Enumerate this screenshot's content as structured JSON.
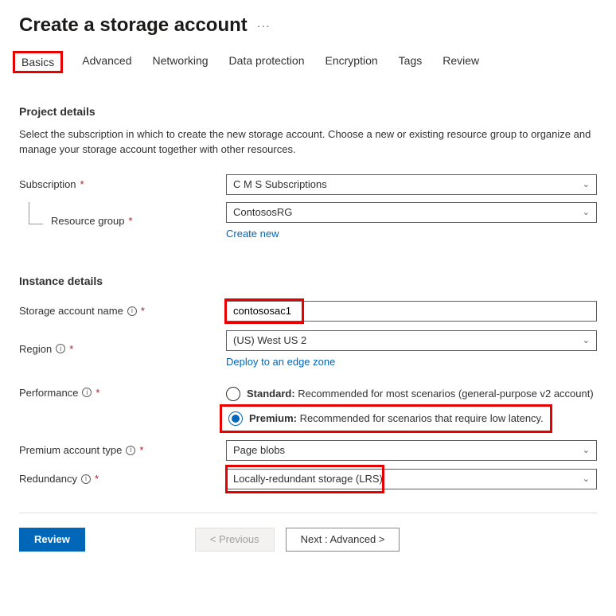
{
  "header": {
    "title": "Create a storage account",
    "ellipsis": "···"
  },
  "tabs": [
    "Basics",
    "Advanced",
    "Networking",
    "Data protection",
    "Encryption",
    "Tags",
    "Review"
  ],
  "project": {
    "heading": "Project details",
    "desc": "Select the subscription in which to create the new storage account. Choose a new or existing resource group to organize and manage your storage account together with other resources.",
    "subscription_label": "Subscription",
    "subscription_value": "C M S Subscriptions",
    "rg_label": "Resource group",
    "rg_value": "ContososRG",
    "create_new": "Create new"
  },
  "instance": {
    "heading": "Instance details",
    "name_label": "Storage account name",
    "name_value": "contososac1",
    "region_label": "Region",
    "region_value": "(US) West US 2",
    "deploy_link": "Deploy to an edge zone",
    "perf_label": "Performance",
    "perf_standard_bold": "Standard:",
    "perf_standard_rest": " Recommended for most scenarios (general-purpose v2 account)",
    "perf_premium_bold": "Premium:",
    "perf_premium_rest": " Recommended for scenarios that require low latency.",
    "premium_type_label": "Premium account type",
    "premium_type_value": "Page blobs",
    "redundancy_label": "Redundancy",
    "redundancy_value": "Locally-redundant storage (LRS)"
  },
  "footer": {
    "review": "Review",
    "previous": "< Previous",
    "next": "Next : Advanced >"
  }
}
